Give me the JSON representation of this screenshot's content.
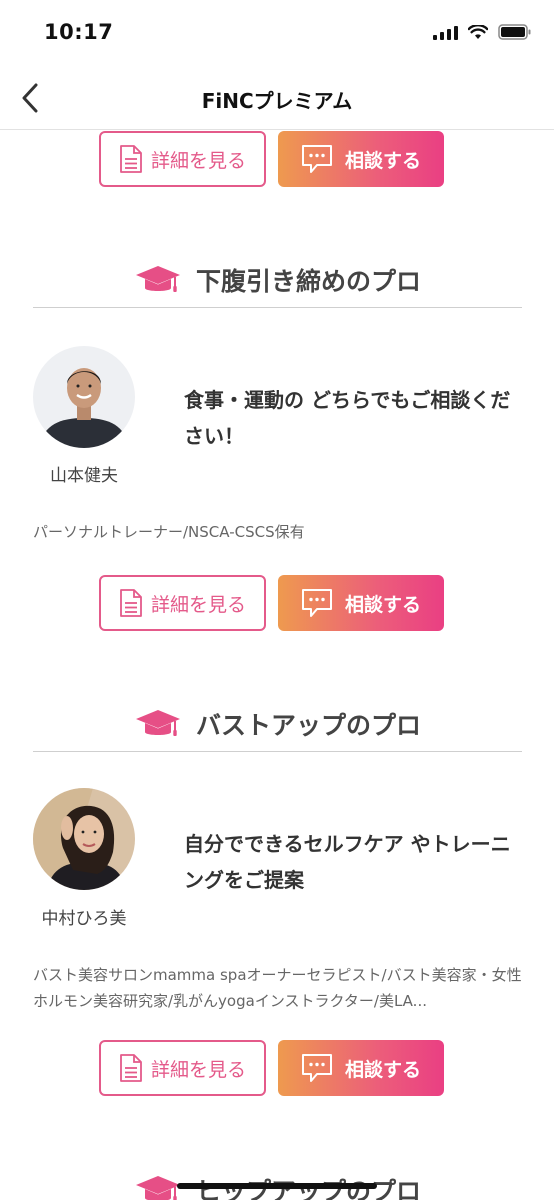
{
  "status": {
    "time": "10:17"
  },
  "nav": {
    "title": "FiNCプレミアム"
  },
  "buttons": {
    "detail_label": "詳細を見る",
    "consult_label": "相談する"
  },
  "sections": [
    {
      "title": "下腹引き締めのプロ",
      "pro": {
        "name": "山本健夫",
        "message": "食事・運動の どちらでもご相談ください！",
        "profile": "パーソナルトレーナー/NSCA-CSCS保有"
      }
    },
    {
      "title": "バストアップのプロ",
      "pro": {
        "name": "中村ひろ美",
        "message": "自分でできるセルフケア やトレーニングをご提案",
        "profile": "バスト美容サロンmamma spaオーナーセラピスト/バスト美容家・女性ホルモン美容研究家/乳がんyogaインストラクター/美LA..."
      }
    },
    {
      "title": "ヒップアップのプロ"
    }
  ],
  "colors": {
    "accent_pink": "#e45a8a",
    "gradient_start": "#ee9a4f",
    "gradient_end": "#ea3f83"
  },
  "icons": {
    "section": "graduation-cap-icon",
    "detail": "document-icon",
    "consult": "chat-bubble-icon"
  }
}
